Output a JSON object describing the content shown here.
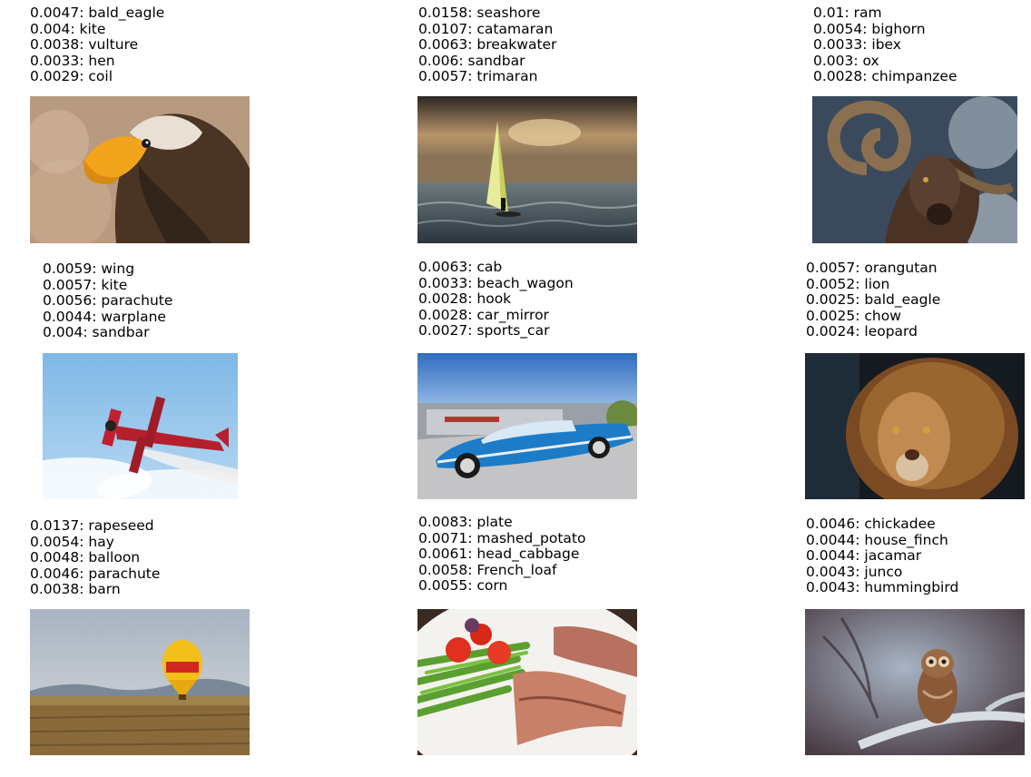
{
  "cells": [
    {
      "predictions": [
        "0.0047: bald_eagle",
        "0.004: kite",
        "0.0038: vulture",
        "0.0033: hen",
        "0.0029: coil"
      ]
    },
    {
      "predictions": [
        "0.0158: seashore",
        "0.0107: catamaran",
        "0.0063: breakwater",
        "0.006: sandbar",
        "0.0057: trimaran"
      ]
    },
    {
      "predictions": [
        "0.01: ram",
        "0.0054: bighorn",
        "0.0033: ibex",
        "0.003: ox",
        "0.0028: chimpanzee"
      ]
    },
    {
      "predictions": [
        "0.0059: wing",
        "0.0057: kite",
        "0.0056: parachute",
        "0.0044: warplane",
        "0.004: sandbar"
      ]
    },
    {
      "predictions": [
        "0.0063: cab",
        "0.0033: beach_wagon",
        "0.0028: hook",
        "0.0028: car_mirror",
        "0.0027: sports_car"
      ]
    },
    {
      "predictions": [
        "0.0057: orangutan",
        "0.0052: lion",
        "0.0025: bald_eagle",
        "0.0025: chow",
        "0.0024: leopard"
      ]
    },
    {
      "predictions": [
        "0.0137: rapeseed",
        "0.0054: hay",
        "0.0048: balloon",
        "0.0046: parachute",
        "0.0038: barn"
      ]
    },
    {
      "predictions": [
        "0.0083: plate",
        "0.0071: mashed_potato",
        "0.0061: head_cabbage",
        "0.0058: French_loaf",
        "0.0055: corn"
      ]
    },
    {
      "predictions": [
        "0.0046: chickadee",
        "0.0044: house_finch",
        "0.0044: jacamar",
        "0.0043: junco",
        "0.0043: hummingbird"
      ]
    }
  ]
}
